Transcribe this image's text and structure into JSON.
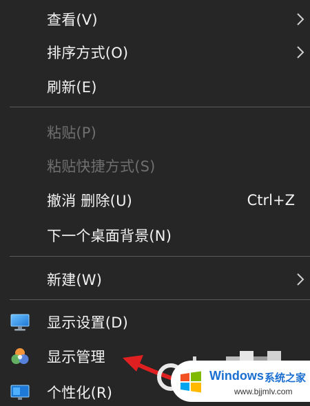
{
  "context_menu": {
    "items": [
      {
        "label": "查看(V)",
        "has_submenu": true,
        "enabled": true
      },
      {
        "label": "排序方式(O)",
        "has_submenu": true,
        "enabled": true
      },
      {
        "label": "刷新(E)",
        "has_submenu": false,
        "enabled": true
      },
      {
        "label": "粘贴(P)",
        "has_submenu": false,
        "enabled": false
      },
      {
        "label": "粘贴快捷方式(S)",
        "has_submenu": false,
        "enabled": false
      },
      {
        "label": "撤消 删除(U)",
        "shortcut": "Ctrl+Z",
        "has_submenu": false,
        "enabled": true
      },
      {
        "label": "下一个桌面背景(N)",
        "has_submenu": false,
        "enabled": true
      },
      {
        "label": "新建(W)",
        "has_submenu": true,
        "enabled": true
      },
      {
        "label": "显示设置(D)",
        "icon": "display-settings-icon",
        "has_submenu": false,
        "enabled": true
      },
      {
        "label": "显示管理",
        "icon": "display-manager-icon",
        "has_submenu": false,
        "enabled": true
      },
      {
        "label": "个性化(R)",
        "icon": "personalize-icon",
        "has_submenu": false,
        "enabled": true
      }
    ]
  },
  "watermark": {
    "title": "Windows",
    "title_cn": "系统之家",
    "url": "www.bjjmlv.com"
  },
  "colors": {
    "menu_bg": "#262626",
    "text": "#f2f2f2",
    "disabled_text": "#6f6f6f",
    "separator": "#5a5a5a",
    "annotation_arrow": "#e02020",
    "watermark_blue": "#1a6fd1"
  }
}
